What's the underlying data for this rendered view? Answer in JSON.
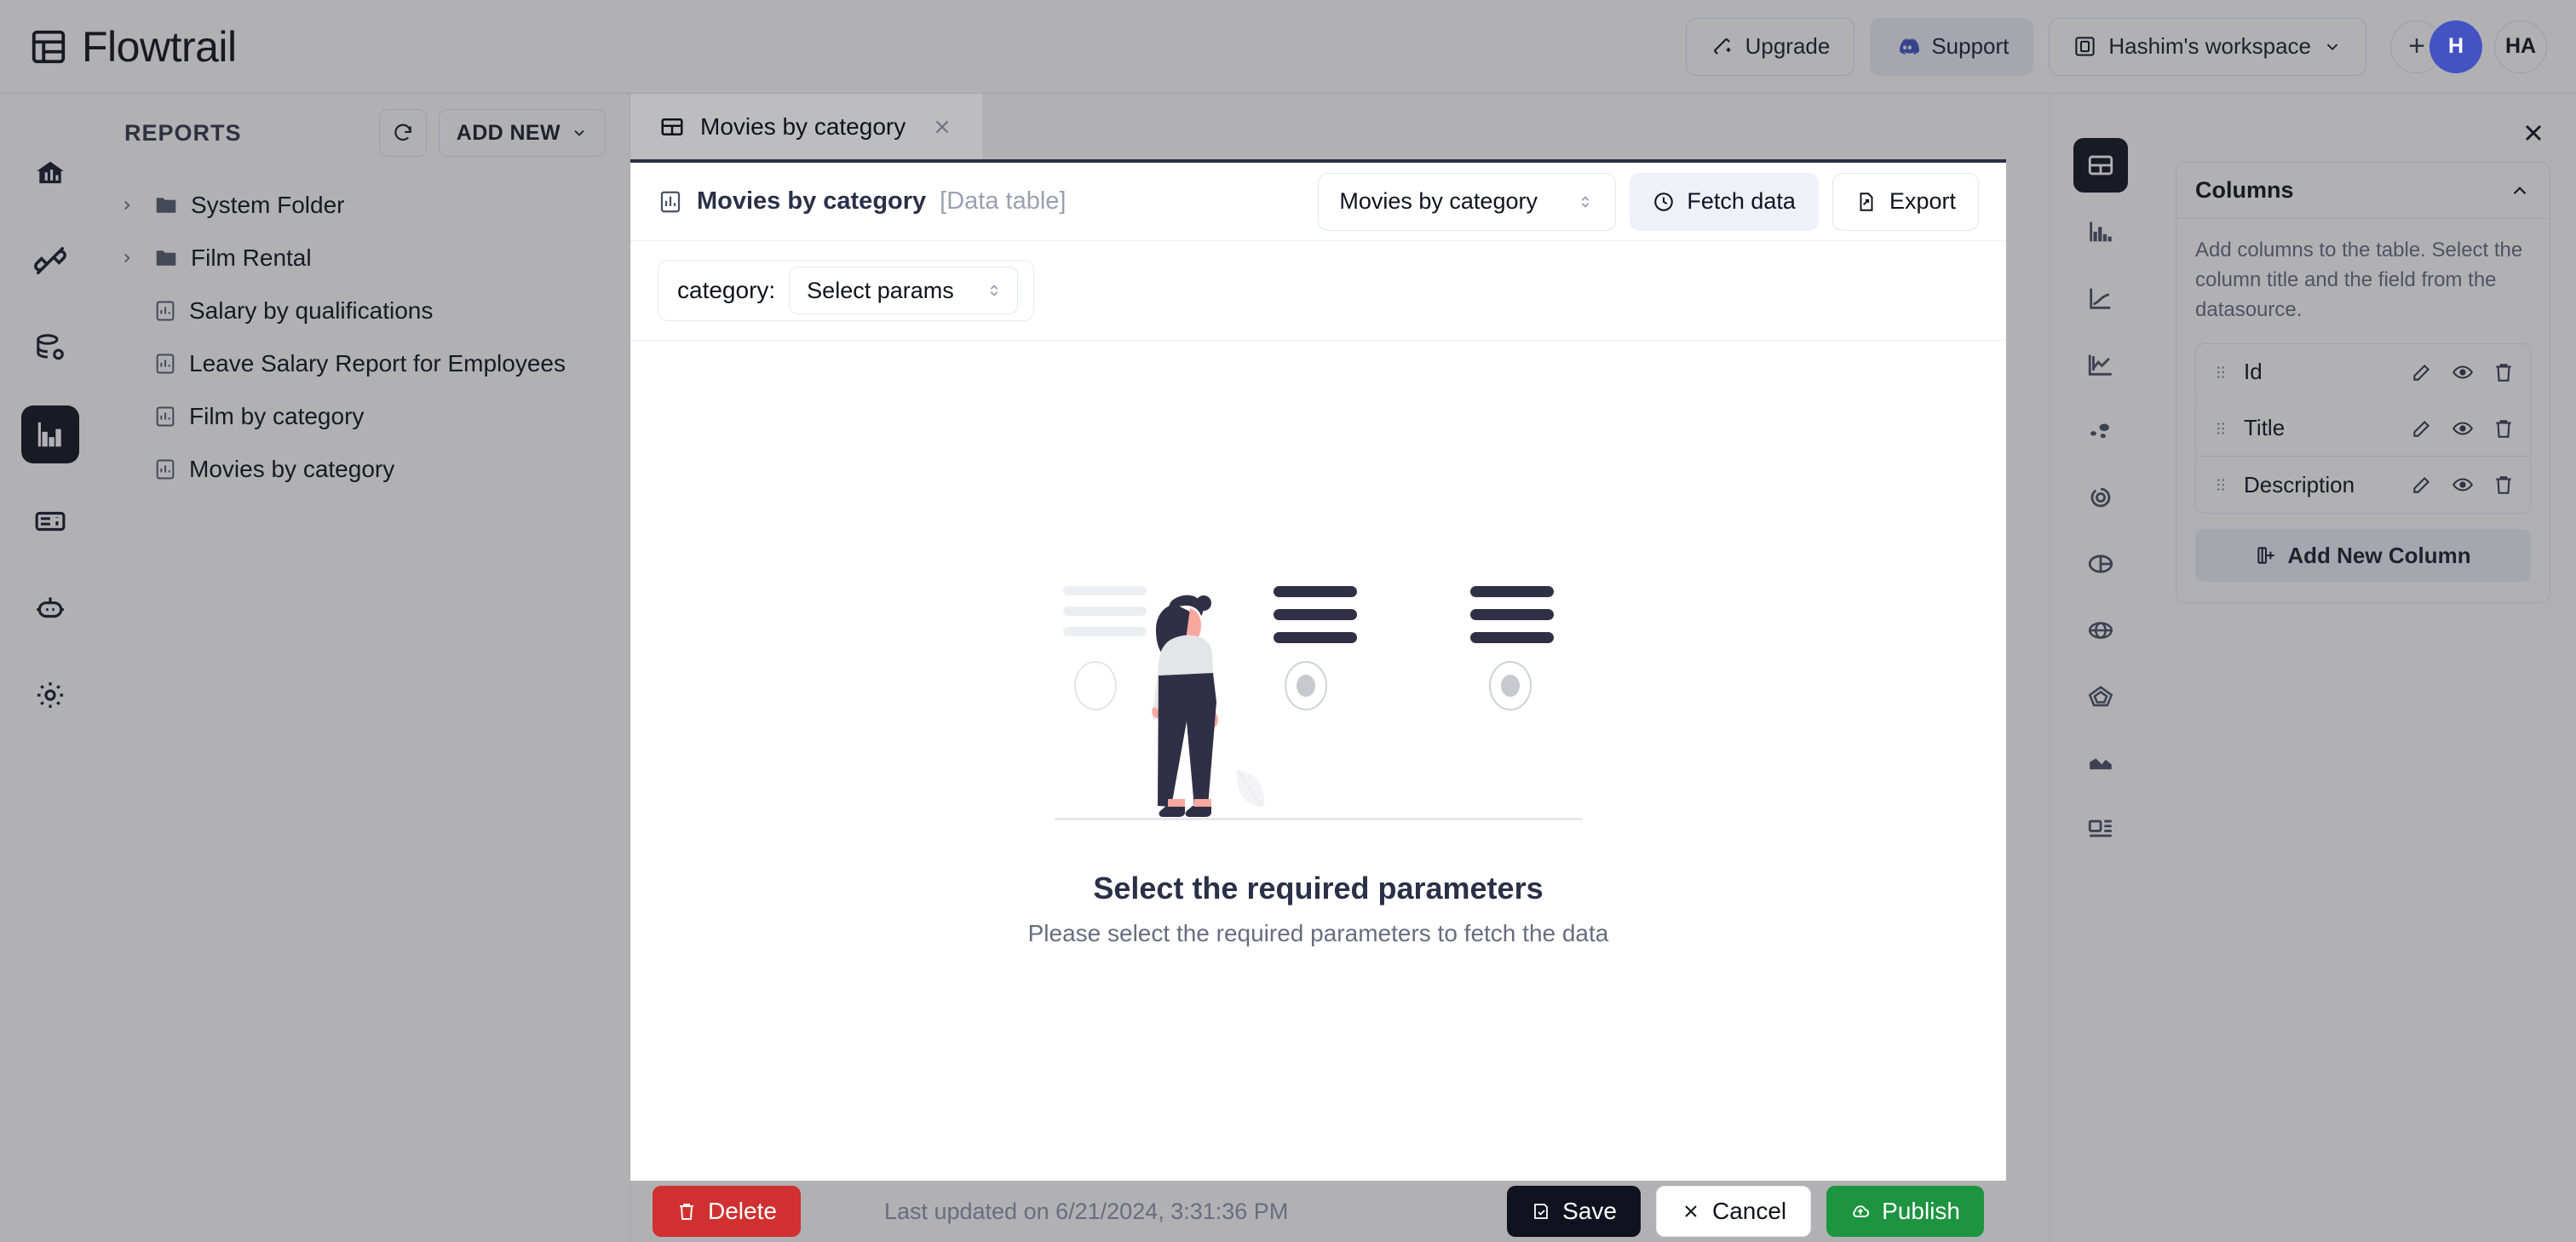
{
  "header": {
    "brand": "Flowtrail",
    "brand_icon": "grid-logo-icon",
    "upgrade_label": "Upgrade",
    "upgrade_icon": "sparkles-icon",
    "support_label": "Support",
    "support_icon": "discord-icon",
    "workspace_label": "Hashim's workspace",
    "workspace_icon": "workspace-icon",
    "workspace_chevron": "chevron-down-icon",
    "avatar_add": "+",
    "avatar_blue_initial": "H",
    "avatar_user_initials": "HA"
  },
  "rail": {
    "items": [
      {
        "name": "home-icon",
        "active": false
      },
      {
        "name": "connections-icon",
        "active": false
      },
      {
        "name": "datasource-settings-icon",
        "active": false
      },
      {
        "name": "reports-icon",
        "active": true
      },
      {
        "name": "dashboard-icon",
        "active": false
      },
      {
        "name": "ai-bot-icon",
        "active": false
      },
      {
        "name": "settings-gear-icon",
        "active": false
      }
    ]
  },
  "reports": {
    "title": "REPORTS",
    "refresh_icon": "refresh-icon",
    "add_new_label": "ADD NEW",
    "add_new_chevron": "chevron-down-icon",
    "tree": [
      {
        "label": "System Folder",
        "type": "folder"
      },
      {
        "label": "Film Rental",
        "type": "folder"
      },
      {
        "label": "Salary by qualifications",
        "type": "report"
      },
      {
        "label": "Leave Salary Report for Employees",
        "type": "report"
      },
      {
        "label": "Film by category",
        "type": "report"
      },
      {
        "label": "Movies by category",
        "type": "report"
      }
    ]
  },
  "chart_types": [
    {
      "name": "table-chart-icon",
      "active": true
    },
    {
      "name": "bar-chart-icon",
      "active": false
    },
    {
      "name": "line-chart-icon",
      "active": false
    },
    {
      "name": "area-line-chart-icon",
      "active": false
    },
    {
      "name": "scatter-chart-icon",
      "active": false
    },
    {
      "name": "donut-chart-icon",
      "active": false
    },
    {
      "name": "pie-chart-icon",
      "active": false
    },
    {
      "name": "polar-chart-icon",
      "active": false
    },
    {
      "name": "radar-chart-icon",
      "active": false
    },
    {
      "name": "area-chart-icon",
      "active": false
    },
    {
      "name": "card-layout-icon",
      "active": false
    }
  ],
  "columns_panel": {
    "close_icon": "close-icon",
    "title": "Columns",
    "collapse_icon": "chevron-up-icon",
    "description": "Add columns to the table. Select the column title and the field from the datasource.",
    "columns": [
      {
        "label": "Id"
      },
      {
        "label": "Title"
      },
      {
        "label": "Description"
      }
    ],
    "row_icons": {
      "drag": "drag-handle-icon",
      "edit": "pencil-icon",
      "visibility": "eye-icon",
      "delete": "trash-icon"
    },
    "add_column_label": "Add New Column",
    "add_column_icon": "add-column-icon"
  },
  "tab": {
    "label": "Movies by category",
    "icon": "table-icon",
    "close_icon": "close-icon"
  },
  "modal": {
    "title": "Movies by category",
    "title_suffix": "[Data table]",
    "title_icon": "bar-chart-box-icon",
    "datasource_value": "Movies by category",
    "datasource_chevron": "chevron-updown-icon",
    "fetch_label": "Fetch data",
    "fetch_icon": "play-circle-icon",
    "export_label": "Export",
    "export_icon": "export-file-icon",
    "params": {
      "label": "category:",
      "select_value": "Select params",
      "select_chevron": "chevron-updown-icon"
    },
    "empty_state": {
      "illustration": "person-choosing-options-illustration",
      "title": "Select the required parameters",
      "subtitle": "Please select the required parameters to fetch the data"
    },
    "footer": {
      "delete_label": "Delete",
      "delete_icon": "trash-icon",
      "last_updated": "Last updated on 6/21/2024, 3:31:36 PM",
      "save_label": "Save",
      "save_icon": "save-icon",
      "cancel_label": "Cancel",
      "cancel_icon": "close-icon",
      "publish_label": "Publish",
      "publish_icon": "publish-cloud-icon"
    }
  },
  "colors": {
    "accent_blue": "#4353c4",
    "danger_red": "#d13030",
    "success_green": "#1d9440",
    "dark": "#10131f",
    "overlay": "rgba(40,40,48,0.36)"
  }
}
